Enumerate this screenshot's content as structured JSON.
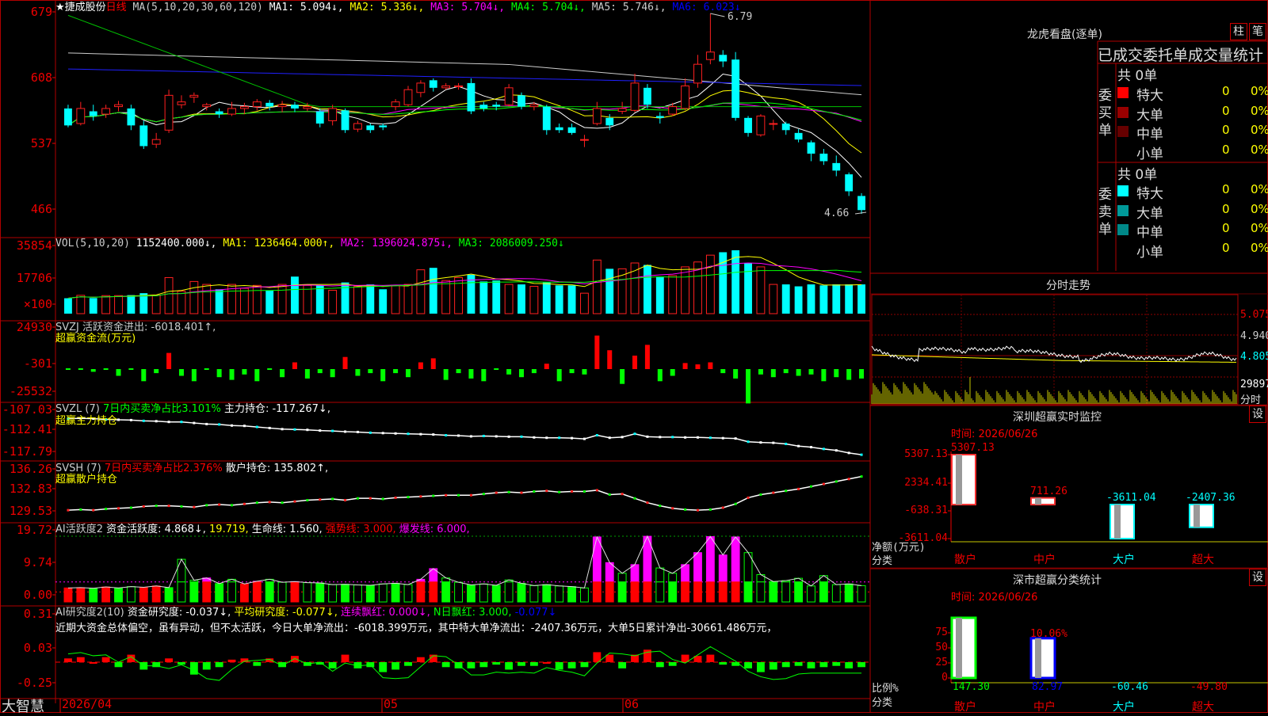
{
  "stock": {
    "name": "★捷成股份",
    "period": "日线"
  },
  "main_header": {
    "ma_label": "MA(5,10,20,30,60,120)",
    "items": [
      {
        "text": "MA1: 5.094↓,",
        "color": "#ffffff"
      },
      {
        "text": "MA2: 5.336↓,",
        "color": "#ffff00"
      },
      {
        "text": "MA3: 5.704↓,",
        "color": "#ff00ff"
      },
      {
        "text": "MA4: 5.704↓,",
        "color": "#00ff00"
      },
      {
        "text": "MA5: 5.746↓,",
        "color": "#cccccc"
      },
      {
        "text": "MA6: 6.023↓",
        "color": "#0000ff"
      }
    ],
    "high_marker": "6.79",
    "low_marker": "4.66"
  },
  "axis": {
    "price": [
      "679",
      "608",
      "537",
      "466"
    ],
    "volume": [
      "35854",
      "17706",
      "×100"
    ],
    "svzj": [
      "24930",
      "-301",
      "-25532"
    ],
    "svzl": [
      "-107.03",
      "-112.41",
      "-117.79"
    ],
    "svsh": [
      "136.26",
      "132.83",
      "129.53"
    ],
    "ai": [
      "19.72",
      "9.74",
      "0.00"
    ],
    "ai2": [
      "0.31",
      "0.03",
      "-0.25"
    ],
    "dates": [
      "2026/04",
      "05",
      "06"
    ]
  },
  "vol_header": [
    {
      "text": "VOL(5,10,20)",
      "color": "#cccccc"
    },
    {
      "text": "1152400.000↓,",
      "color": "#ffffff"
    },
    {
      "text": "MA1: 1236464.000↑,",
      "color": "#ffff00"
    },
    {
      "text": "MA2: 1396024.875↓,",
      "color": "#ff00ff"
    },
    {
      "text": "MA3: 2086009.250↓",
      "color": "#00ff00"
    }
  ],
  "svzj_header": {
    "line1": "SVZJ  活跃资金进出: -6018.401↑,",
    "line2": "超赢资金流(万元)"
  },
  "svzl_header": [
    {
      "text": "SVZL (7)",
      "color": "#cccccc"
    },
    {
      "text": "7日内买卖净占比3.101%",
      "color": "#00ff00"
    },
    {
      "text": "主力持仓: -117.267↓,",
      "color": "#ffffff"
    }
  ],
  "svzl_sub": "超赢主力持仓",
  "svsh_header": [
    {
      "text": "SVSH (7)",
      "color": "#cccccc"
    },
    {
      "text": "7日内买卖净占比2.376%",
      "color": "#ff0000"
    },
    {
      "text": "散户持仓: 135.802↑,",
      "color": "#ffffff"
    }
  ],
  "svsh_sub": "超赢散户持仓",
  "ai_header": [
    {
      "text": "AI活跃度2",
      "color": "#cccccc"
    },
    {
      "text": "资金活跃度: 4.868↓,",
      "color": "#ffffff"
    },
    {
      "text": "19.719,",
      "color": "#ffff00"
    },
    {
      "text": "生命线: 1.560,",
      "color": "#ffffff"
    },
    {
      "text": "强势线: 3.000,",
      "color": "#ff0000"
    },
    {
      "text": "爆发线: 6.000,",
      "color": "#ff00ff"
    }
  ],
  "ai2_header": [
    {
      "text": "AI研究度2(10)",
      "color": "#cccccc"
    },
    {
      "text": "资金研究度: -0.037↓,",
      "color": "#ffffff"
    },
    {
      "text": "平均研究度: -0.077↓,",
      "color": "#ffff00"
    },
    {
      "text": "连续飘红: 0.000↓,",
      "color": "#ff00ff"
    },
    {
      "text": "N日飘红: 3.000,",
      "color": "#00ff00"
    },
    {
      "text": "-0.077↓",
      "color": "#0000ff"
    }
  ],
  "ai2_comment": "近期大资金总体偏空，虽有异动，但不太活跃，今日大单净流出：-6018.399万元，其中特大单净流出：-2407.36万元，大单5日累计净出-30661.486万元，",
  "brand": "大智慧",
  "right": {
    "dragon": {
      "title": "龙虎看盘(逐单)",
      "btn1": "柱",
      "btn2": "笔"
    },
    "order_stats": {
      "title": "已成交委托单成交量统计",
      "buy_label": "委买单",
      "sell_label": "委卖单",
      "buy_total": "共 0单",
      "sell_total": "共 0单",
      "buy_rows": [
        {
          "name": "特大",
          "value": "0",
          "pct": "0%",
          "color": "#ff0000"
        },
        {
          "name": "大单",
          "value": "0",
          "pct": "0%",
          "color": "#990000"
        },
        {
          "name": "中单",
          "value": "0",
          "pct": "0%",
          "color": "#660000"
        },
        {
          "name": "小单",
          "value": "0",
          "pct": "0%",
          "color": ""
        }
      ],
      "sell_rows": [
        {
          "name": "特大",
          "value": "0",
          "pct": "0%",
          "color": "#00ffff"
        },
        {
          "name": "大单",
          "value": "0",
          "pct": "0%",
          "color": "#009999"
        },
        {
          "name": "中单",
          "value": "0",
          "pct": "0%",
          "color": "#008888"
        },
        {
          "name": "小单",
          "value": "0",
          "pct": "0%",
          "color": ""
        }
      ]
    },
    "intraday": {
      "title": "分时走势",
      "prices": [
        "5.075",
        "4.940",
        "4.805"
      ],
      "vol": "29897",
      "unit": "分时"
    },
    "monitor": {
      "title": "深圳超赢实时监控",
      "btn": "设",
      "time": "时间: 2026/06/26",
      "yaxis": [
        "5307.13",
        "2334.41",
        "-638.31",
        "-3611.04"
      ],
      "ylabel": "净额(万元)",
      "xlabel": "分类",
      "cats": [
        "散户",
        "中户",
        "大户",
        "超大"
      ],
      "values": [
        5307.13,
        711.26,
        -3611.04,
        -2407.36
      ],
      "value_labels": [
        "5307.13",
        "711.26",
        "-3611.04",
        "-2407.36"
      ]
    },
    "classify": {
      "title": "深市超赢分类统计",
      "btn": "设",
      "time": "时间: 2026/06/26",
      "yaxis": [
        "75",
        "50",
        "25",
        "0"
      ],
      "ylabel": "比例%",
      "xlabel": "分类",
      "cats": [
        "散户",
        "中户",
        "大户",
        "超大"
      ],
      "bar_pct": [
        100,
        66
      ],
      "pct_label": "10.06%",
      "values": [
        "147.30",
        "82.97",
        "-60.46",
        "-49.80"
      ]
    }
  },
  "chart_data": {
    "type": "candlestick",
    "title": "捷成股份 日线",
    "ylim": [
      4.4,
      6.95
    ],
    "candles": [
      [
        5.78,
        5.6,
        5.82,
        5.58
      ],
      [
        5.62,
        5.78,
        5.85,
        5.6
      ],
      [
        5.75,
        5.7,
        5.82,
        5.65
      ],
      [
        5.72,
        5.78,
        5.82,
        5.68
      ],
      [
        5.8,
        5.82,
        5.86,
        5.75
      ],
      [
        5.78,
        5.6,
        5.82,
        5.55
      ],
      [
        5.6,
        5.38,
        5.65,
        5.35
      ],
      [
        5.4,
        5.45,
        5.52,
        5.36
      ],
      [
        5.55,
        5.92,
        5.98,
        5.52
      ],
      [
        5.82,
        5.85,
        5.92,
        5.78
      ],
      [
        5.9,
        5.92,
        5.95,
        5.84
      ],
      [
        5.8,
        5.82,
        5.84,
        5.76
      ],
      [
        5.75,
        5.72,
        5.78,
        5.68
      ],
      [
        5.72,
        5.78,
        5.85,
        5.7
      ],
      [
        5.78,
        5.8,
        5.84,
        5.72
      ],
      [
        5.8,
        5.85,
        5.88,
        5.76
      ],
      [
        5.84,
        5.8,
        5.87,
        5.76
      ],
      [
        5.8,
        5.82,
        5.86,
        5.74
      ],
      [
        5.82,
        5.78,
        5.85,
        5.74
      ],
      [
        5.78,
        5.8,
        5.84,
        5.75
      ],
      [
        5.75,
        5.62,
        5.78,
        5.58
      ],
      [
        5.65,
        5.78,
        5.82,
        5.6
      ],
      [
        5.76,
        5.55,
        5.78,
        5.52
      ],
      [
        5.56,
        5.62,
        5.65,
        5.53
      ],
      [
        5.6,
        5.55,
        5.62,
        5.52
      ],
      [
        5.6,
        5.58,
        5.62,
        5.55
      ],
      [
        5.8,
        5.85,
        5.88,
        5.76
      ],
      [
        5.82,
        5.98,
        6.02,
        5.8
      ],
      [
        5.95,
        6.05,
        6.08,
        5.9
      ],
      [
        6.08,
        6.0,
        6.1,
        5.96
      ],
      [
        6.0,
        6.02,
        6.05,
        5.98
      ],
      [
        6.02,
        6.02,
        6.05,
        5.98
      ],
      [
        6.05,
        5.75,
        6.1,
        5.72
      ],
      [
        5.82,
        5.78,
        5.85,
        5.75
      ],
      [
        5.82,
        5.8,
        5.85,
        5.76
      ],
      [
        5.82,
        6.0,
        6.04,
        5.8
      ],
      [
        5.92,
        5.8,
        5.95,
        5.77
      ],
      [
        5.8,
        5.82,
        5.85,
        5.76
      ],
      [
        5.8,
        5.55,
        5.82,
        5.5
      ],
      [
        5.58,
        5.55,
        5.62,
        5.52
      ],
      [
        5.58,
        5.52,
        5.62,
        5.5
      ],
      [
        5.45,
        5.45,
        5.5,
        5.37
      ],
      [
        5.62,
        5.78,
        5.85,
        5.6
      ],
      [
        5.68,
        5.6,
        5.72,
        5.55
      ],
      [
        5.75,
        5.78,
        5.85,
        5.72
      ],
      [
        5.76,
        6.05,
        6.15,
        5.74
      ],
      [
        6.0,
        5.82,
        6.04,
        5.78
      ],
      [
        5.7,
        5.68,
        5.74,
        5.62
      ],
      [
        5.72,
        5.8,
        5.84,
        5.7
      ],
      [
        5.78,
        6.02,
        6.1,
        5.76
      ],
      [
        6.05,
        6.25,
        6.35,
        6.0
      ],
      [
        6.3,
        6.38,
        6.79,
        6.25
      ],
      [
        6.35,
        6.28,
        6.4,
        6.22
      ],
      [
        6.3,
        5.68,
        6.38,
        5.65
      ],
      [
        5.68,
        5.52,
        5.7,
        5.48
      ],
      [
        5.5,
        5.7,
        5.72,
        5.48
      ],
      [
        5.62,
        5.62,
        5.66,
        5.55
      ],
      [
        5.62,
        5.55,
        5.64,
        5.5
      ],
      [
        5.52,
        5.45,
        5.56,
        5.42
      ],
      [
        5.42,
        5.3,
        5.44,
        5.22
      ],
      [
        5.3,
        5.22,
        5.35,
        5.18
      ],
      [
        5.2,
        5.12,
        5.28,
        5.06
      ],
      [
        5.08,
        4.9,
        5.1,
        4.85
      ],
      [
        4.85,
        4.7,
        4.88,
        4.66
      ]
    ],
    "volume": [
      158,
      188,
      160,
      185,
      185,
      190,
      210,
      190,
      370,
      230,
      330,
      300,
      250,
      300,
      260,
      290,
      240,
      300,
      380,
      290,
      290,
      240,
      320,
      280,
      300,
      250,
      290,
      300,
      450,
      470,
      340,
      370,
      400,
      330,
      340,
      300,
      300,
      280,
      320,
      290,
      290,
      210,
      550,
      460,
      460,
      520,
      500,
      380,
      390,
      480,
      530,
      600,
      630,
      650,
      520,
      480,
      300,
      300,
      280,
      300,
      290,
      300,
      300,
      300
    ],
    "svzj": [
      0,
      0,
      -2000,
      0,
      -5000,
      0,
      -9000,
      -3000,
      12000,
      -5000,
      -9000,
      0,
      -6000,
      -8000,
      -4000,
      -9000,
      0,
      -6000,
      5000,
      -7000,
      -3000,
      -6000,
      9000,
      -5000,
      -3000,
      -9000,
      -3000,
      -6000,
      5000,
      8000,
      -8000,
      -3000,
      -7000,
      -9000,
      0,
      -4000,
      -6000,
      -3000,
      4000,
      -9000,
      -3000,
      -4000,
      24900,
      14000,
      -11000,
      10000,
      18000,
      -9000,
      -5000,
      4500,
      3500,
      5000,
      -3000,
      -7000,
      -25500,
      -4000,
      -6000,
      -3000,
      -5000,
      -4000,
      -9000,
      -6000,
      -8000,
      -7000
    ],
    "svzl": [
      -107.6,
      -107.5,
      -107.6,
      -107.8,
      -107.9,
      -108.0,
      -108.2,
      -108.3,
      -108.5,
      -108.5,
      -108.8,
      -109.1,
      -109.2,
      -109.5,
      -109.6,
      -109.9,
      -110.2,
      -110.5,
      -110.6,
      -110.7,
      -110.9,
      -111.0,
      -111.2,
      -111.3,
      -111.5,
      -111.6,
      -111.7,
      -111.8,
      -111.9,
      -112.0,
      -112.2,
      -112.3,
      -112.5,
      -112.4,
      -112.5,
      -112.6,
      -112.6,
      -112.8,
      -112.9,
      -112.9,
      -113.0,
      -113.2,
      -112.2,
      -112.9,
      -112.7,
      -111.8,
      -112.6,
      -112.7,
      -112.7,
      -112.8,
      -112.8,
      -112.9,
      -113.0,
      -113.1,
      -114.0,
      -114.2,
      -114.3,
      -114.6,
      -115.2,
      -115.5,
      -116.0,
      -116.4,
      -117.1,
      -117.6
    ],
    "svsh": [
      130.4,
      130.5,
      130.4,
      130.6,
      130.7,
      130.8,
      131.0,
      131.1,
      131.1,
      131.0,
      130.9,
      131.2,
      131.3,
      131.2,
      131.4,
      131.6,
      131.7,
      131.6,
      131.8,
      132.0,
      132.1,
      132.2,
      132.0,
      132.3,
      132.3,
      132.2,
      132.4,
      132.5,
      132.6,
      132.7,
      132.8,
      132.8,
      132.8,
      133.0,
      133.2,
      133.3,
      133.2,
      133.4,
      133.5,
      133.3,
      133.4,
      133.4,
      133.6,
      132.9,
      133.0,
      132.3,
      131.6,
      131.1,
      130.7,
      130.5,
      130.4,
      130.5,
      130.8,
      131.4,
      132.4,
      132.9,
      133.2,
      133.5,
      133.8,
      134.2,
      134.6,
      135.0,
      135.4,
      135.8
    ],
    "ai": [
      4.2,
      4.3,
      4.1,
      4.5,
      4.2,
      4.6,
      4.4,
      4.8,
      4.3,
      12.8,
      6.5,
      7.2,
      5.5,
      6.8,
      5.4,
      6.2,
      6.8,
      5.9,
      6.1,
      5.8,
      5.7,
      5.2,
      5.3,
      5.1,
      5.0,
      5.4,
      5.6,
      5.2,
      6.8,
      10.0,
      7.2,
      5.9,
      5.1,
      5.4,
      5.0,
      6.6,
      5.6,
      4.9,
      5.2,
      4.8,
      4.6,
      4.2,
      19.5,
      11.8,
      8.6,
      11.2,
      19.7,
      10.2,
      8.6,
      11.2,
      14.8,
      19.6,
      14.1,
      19.5,
      14.8,
      8.2,
      6.1,
      6.4,
      7.1,
      4.8,
      7.9,
      5.2,
      5.4,
      4.9
    ],
    "ai_red": [
      1,
      1,
      0,
      1,
      0,
      0,
      1,
      1,
      0,
      0,
      0,
      1,
      0,
      0,
      1,
      1,
      0,
      0,
      1,
      0,
      0,
      0,
      0,
      0,
      0,
      0,
      0,
      0,
      1,
      1,
      0,
      0,
      0,
      0,
      0,
      0,
      0,
      0,
      0,
      0,
      0,
      0,
      1,
      1,
      0,
      1,
      1,
      0,
      0,
      1,
      1,
      1,
      1,
      1,
      0,
      0,
      0,
      0,
      0,
      0,
      0,
      0,
      0,
      0
    ],
    "ai2": [
      0.03,
      0.04,
      0.0,
      0.04,
      -0.04,
      0.06,
      -0.06,
      -0.04,
      0.03,
      -0.02,
      -0.1,
      -0.06,
      -0.04,
      0.02,
      0.03,
      -0.03,
      0.03,
      -0.04,
      0.05,
      -0.03,
      -0.02,
      -0.05,
      0.06,
      -0.05,
      -0.04,
      -0.08,
      -0.06,
      -0.03,
      0.04,
      0.06,
      -0.04,
      -0.05,
      -0.05,
      -0.04,
      -0.02,
      -0.06,
      -0.03,
      -0.03,
      0.0,
      -0.06,
      -0.05,
      -0.04,
      0.08,
      0.06,
      -0.05,
      0.06,
      0.1,
      -0.04,
      -0.03,
      0.06,
      0.05,
      0.06,
      -0.02,
      -0.03,
      -0.05,
      -0.08,
      -0.06,
      -0.04,
      -0.03,
      -0.05,
      -0.04,
      -0.03,
      -0.05,
      -0.04
    ]
  }
}
